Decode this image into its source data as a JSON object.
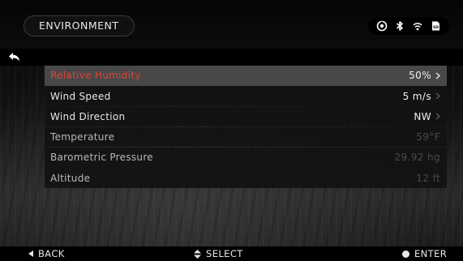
{
  "header": {
    "title": "ENVIRONMENT",
    "status_icons": [
      "rangefinder-icon",
      "bluetooth-icon",
      "wifi-icon",
      "sd-card-icon"
    ],
    "sd_label": "SD"
  },
  "menu": {
    "items": [
      {
        "label": "Relative Humidity",
        "value": "50%",
        "selected": true,
        "editable": true
      },
      {
        "label": "Wind Speed",
        "value": "5 m/s",
        "selected": false,
        "editable": true
      },
      {
        "label": "Wind Direction",
        "value": "NW",
        "selected": false,
        "editable": true
      },
      {
        "label": "Temperature",
        "value": "59°F",
        "selected": false,
        "editable": false
      },
      {
        "label": "Barometric Pressure",
        "value": "29.92 hg",
        "selected": false,
        "editable": false
      },
      {
        "label": "Altitude",
        "value": "12 ft",
        "selected": false,
        "editable": false
      }
    ]
  },
  "footer": {
    "back_label": "BACK",
    "select_label": "SELECT",
    "enter_label": "ENTER"
  },
  "colors": {
    "selected_label": "#e0433a",
    "selected_row": "#484848",
    "row_bg": "#121212",
    "text": "#e8e8e8",
    "dim_value": "#4a4a4a"
  }
}
